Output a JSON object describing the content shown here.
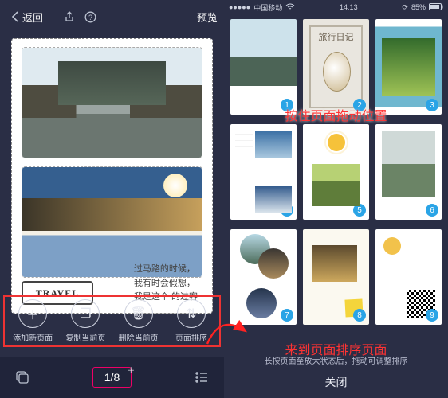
{
  "left": {
    "header": {
      "back_label": "返回",
      "preview_label": "预览"
    },
    "canvas": {
      "travel_badge": "TRAVEL",
      "caption_line1": "过马路的时候，",
      "caption_line2": "我有时会假想，",
      "caption_line3": "我是这个                  的过客"
    },
    "toolbar": [
      {
        "icon": "＋",
        "label": "添加新页面",
        "name": "add-page-button"
      },
      {
        "icon": "❐",
        "label": "复制当前页",
        "name": "duplicate-page-button"
      },
      {
        "icon": "🗑",
        "label": "删除当前页",
        "name": "delete-page-button"
      },
      {
        "icon": "⇅",
        "label": "页面排序",
        "name": "sort-pages-button"
      }
    ],
    "bottom": {
      "page_indicator": "1/8"
    }
  },
  "right": {
    "status": {
      "carrier": "中国移动",
      "time": "14:13",
      "battery": "85%"
    },
    "diary_title": "旅行日记",
    "thumbs": [
      {
        "num": "1"
      },
      {
        "num": "2"
      },
      {
        "num": "3"
      },
      {
        "num": "4"
      },
      {
        "num": "5"
      },
      {
        "num": "6"
      },
      {
        "num": "7"
      },
      {
        "num": "8"
      },
      {
        "num": "9"
      }
    ],
    "hint_drag": "按住页面拖动位置",
    "hint_arrive": "来到页面排序页面",
    "footer_hint": "长按页面至放大状态后，拖动可调整排序",
    "close_label": "关闭"
  }
}
